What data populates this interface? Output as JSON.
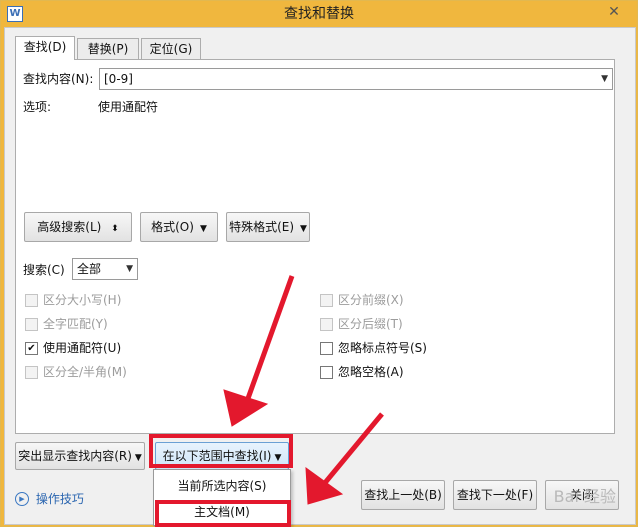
{
  "window": {
    "title": "查找和替换",
    "app_icon": "W",
    "close_glyph": "✕"
  },
  "tabs": [
    {
      "label": "查找(D)"
    },
    {
      "label": "替换(P)"
    },
    {
      "label": "定位(G)"
    }
  ],
  "find": {
    "label": "查找内容(N):",
    "value": "[0-9]",
    "options_label": "选项:",
    "options_value": "使用通配符"
  },
  "buttons": {
    "advanced": "高级搜索(L)",
    "advanced_glyph": "⬍",
    "format": "格式(O)",
    "special": "特殊格式(E)",
    "highlight": "突出显示查找内容(R)",
    "find_in": "在以下范围中查找(I)",
    "find_prev": "查找上一处(B)",
    "find_next": "查找下一处(F)",
    "close": "关闭",
    "tips": "操作技巧"
  },
  "search": {
    "label": "搜索(C)",
    "value": "全部"
  },
  "checkboxes_left": [
    {
      "label": "区分大小写(H)",
      "checked": false,
      "enabled": false
    },
    {
      "label": "全字匹配(Y)",
      "checked": false,
      "enabled": false
    },
    {
      "label": "使用通配符(U)",
      "checked": true,
      "enabled": true
    },
    {
      "label": "区分全/半角(M)",
      "checked": false,
      "enabled": false
    }
  ],
  "checkboxes_right": [
    {
      "label": "区分前缀(X)",
      "checked": false,
      "enabled": false
    },
    {
      "label": "区分后缀(T)",
      "checked": false,
      "enabled": false
    },
    {
      "label": "忽略标点符号(S)",
      "checked": false,
      "enabled": true
    },
    {
      "label": "忽略空格(A)",
      "checked": false,
      "enabled": true
    }
  ],
  "dropdown": {
    "items": [
      {
        "label": "当前所选内容(S)"
      },
      {
        "label": "主文档(M)"
      }
    ]
  },
  "annotation_color": "#e3182d",
  "watermark": "Bai 经验"
}
